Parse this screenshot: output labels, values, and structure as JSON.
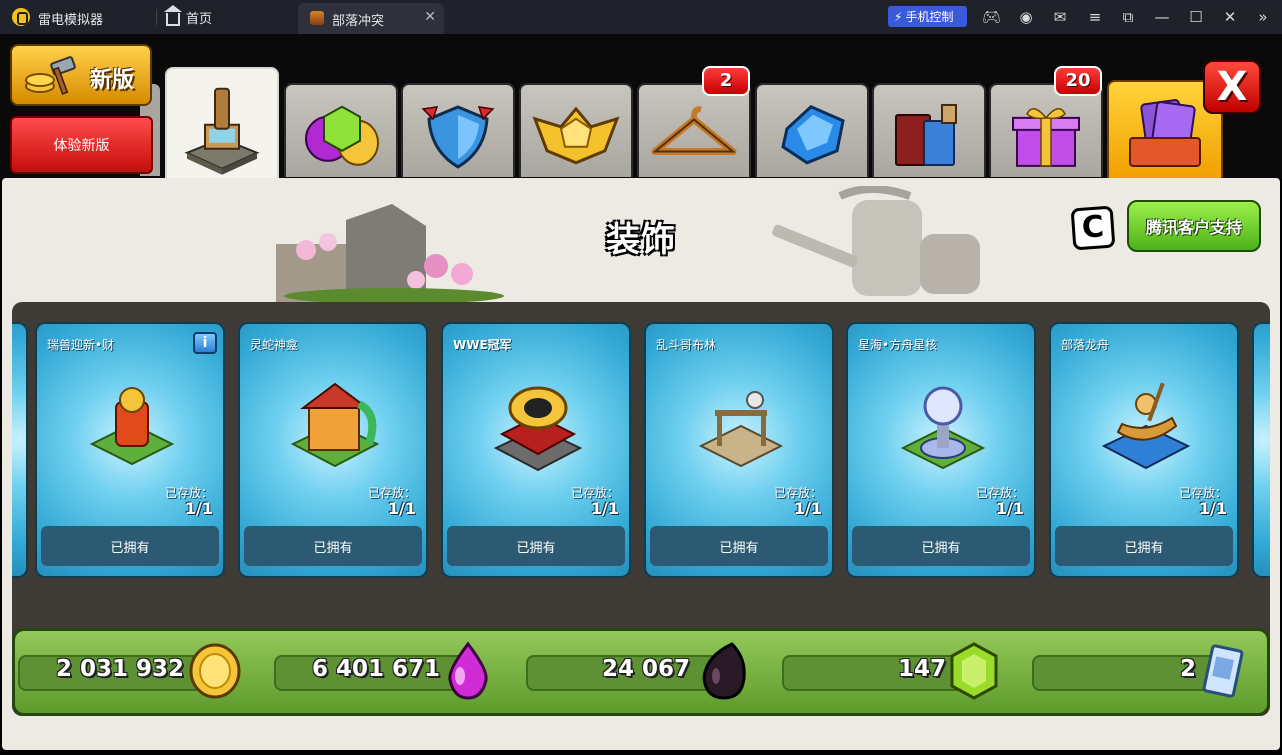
{
  "emulator": {
    "app_name": "雷电模拟器",
    "home_label": "首页",
    "tab_title": "部落冲突",
    "phone_control_label": "手机控制",
    "icons": [
      "gamepad-icon",
      "account-icon",
      "mail-icon",
      "menu-icon",
      "window-icon",
      "minimize-icon",
      "maximize-icon",
      "close-icon",
      "expand-icon"
    ]
  },
  "game_header": {
    "new_version_label": "新版",
    "try_new_version_label": "体验新版",
    "tabs": [
      {
        "name": "decorations-tab",
        "icon": "statue-icon",
        "active": true
      },
      {
        "name": "gems-tab",
        "icon": "gem-coin-icon"
      },
      {
        "name": "shield-tab",
        "icon": "shield-icon"
      },
      {
        "name": "league-tab",
        "icon": "league-badge-icon"
      },
      {
        "name": "hanger-tab",
        "icon": "hanger-icon",
        "badge": "2"
      },
      {
        "name": "crystal-tab",
        "icon": "crystal-icon"
      },
      {
        "name": "books-tab",
        "icon": "book-potion-icon"
      },
      {
        "name": "gift-tab",
        "icon": "gift-icon",
        "badge": "20"
      },
      {
        "name": "cards-tab",
        "icon": "card-chest-icon"
      }
    ],
    "close_label": "X"
  },
  "shop": {
    "title": "装饰",
    "creator_badge": "C",
    "support_button_label": "腾讯客户支持",
    "cards": [
      {
        "name": "瑞兽迎新•财",
        "stored_label": "已存放：",
        "count": "1/1",
        "status": "已拥有",
        "info": "i",
        "item_color": "#e34a1b"
      },
      {
        "name": "灵蛇神龛",
        "stored_label": "已存放：",
        "count": "1/1",
        "status": "已拥有",
        "item_color": "#c73a2a"
      },
      {
        "name": "WWE冠军",
        "stored_label": "已存放：",
        "count": "1/1",
        "status": "已拥有",
        "item_color": "#b81f1f"
      },
      {
        "name": "乱斗哥布林",
        "stored_label": "已存放：",
        "count": "1/1",
        "status": "已拥有",
        "item_color": "#c9b48a"
      },
      {
        "name": "星海•方舟星核",
        "stored_label": "已存放：",
        "count": "1/1",
        "status": "已拥有",
        "item_color": "#7f8fd8"
      },
      {
        "name": "部落龙舟",
        "stored_label": "已存放：",
        "count": "1/1",
        "status": "已拥有",
        "item_color": "#2f7fd6"
      }
    ]
  },
  "resources": {
    "gold": "2 031 932",
    "elixir": "6 401 671",
    "dark_elixir": "24 067",
    "gems": "147",
    "tickets": "2"
  },
  "colors": {
    "card_blue": "#33a9d5",
    "resource_green": "#5e9b2c",
    "badge_red": "#d90000",
    "support_green": "#4eb11a"
  }
}
